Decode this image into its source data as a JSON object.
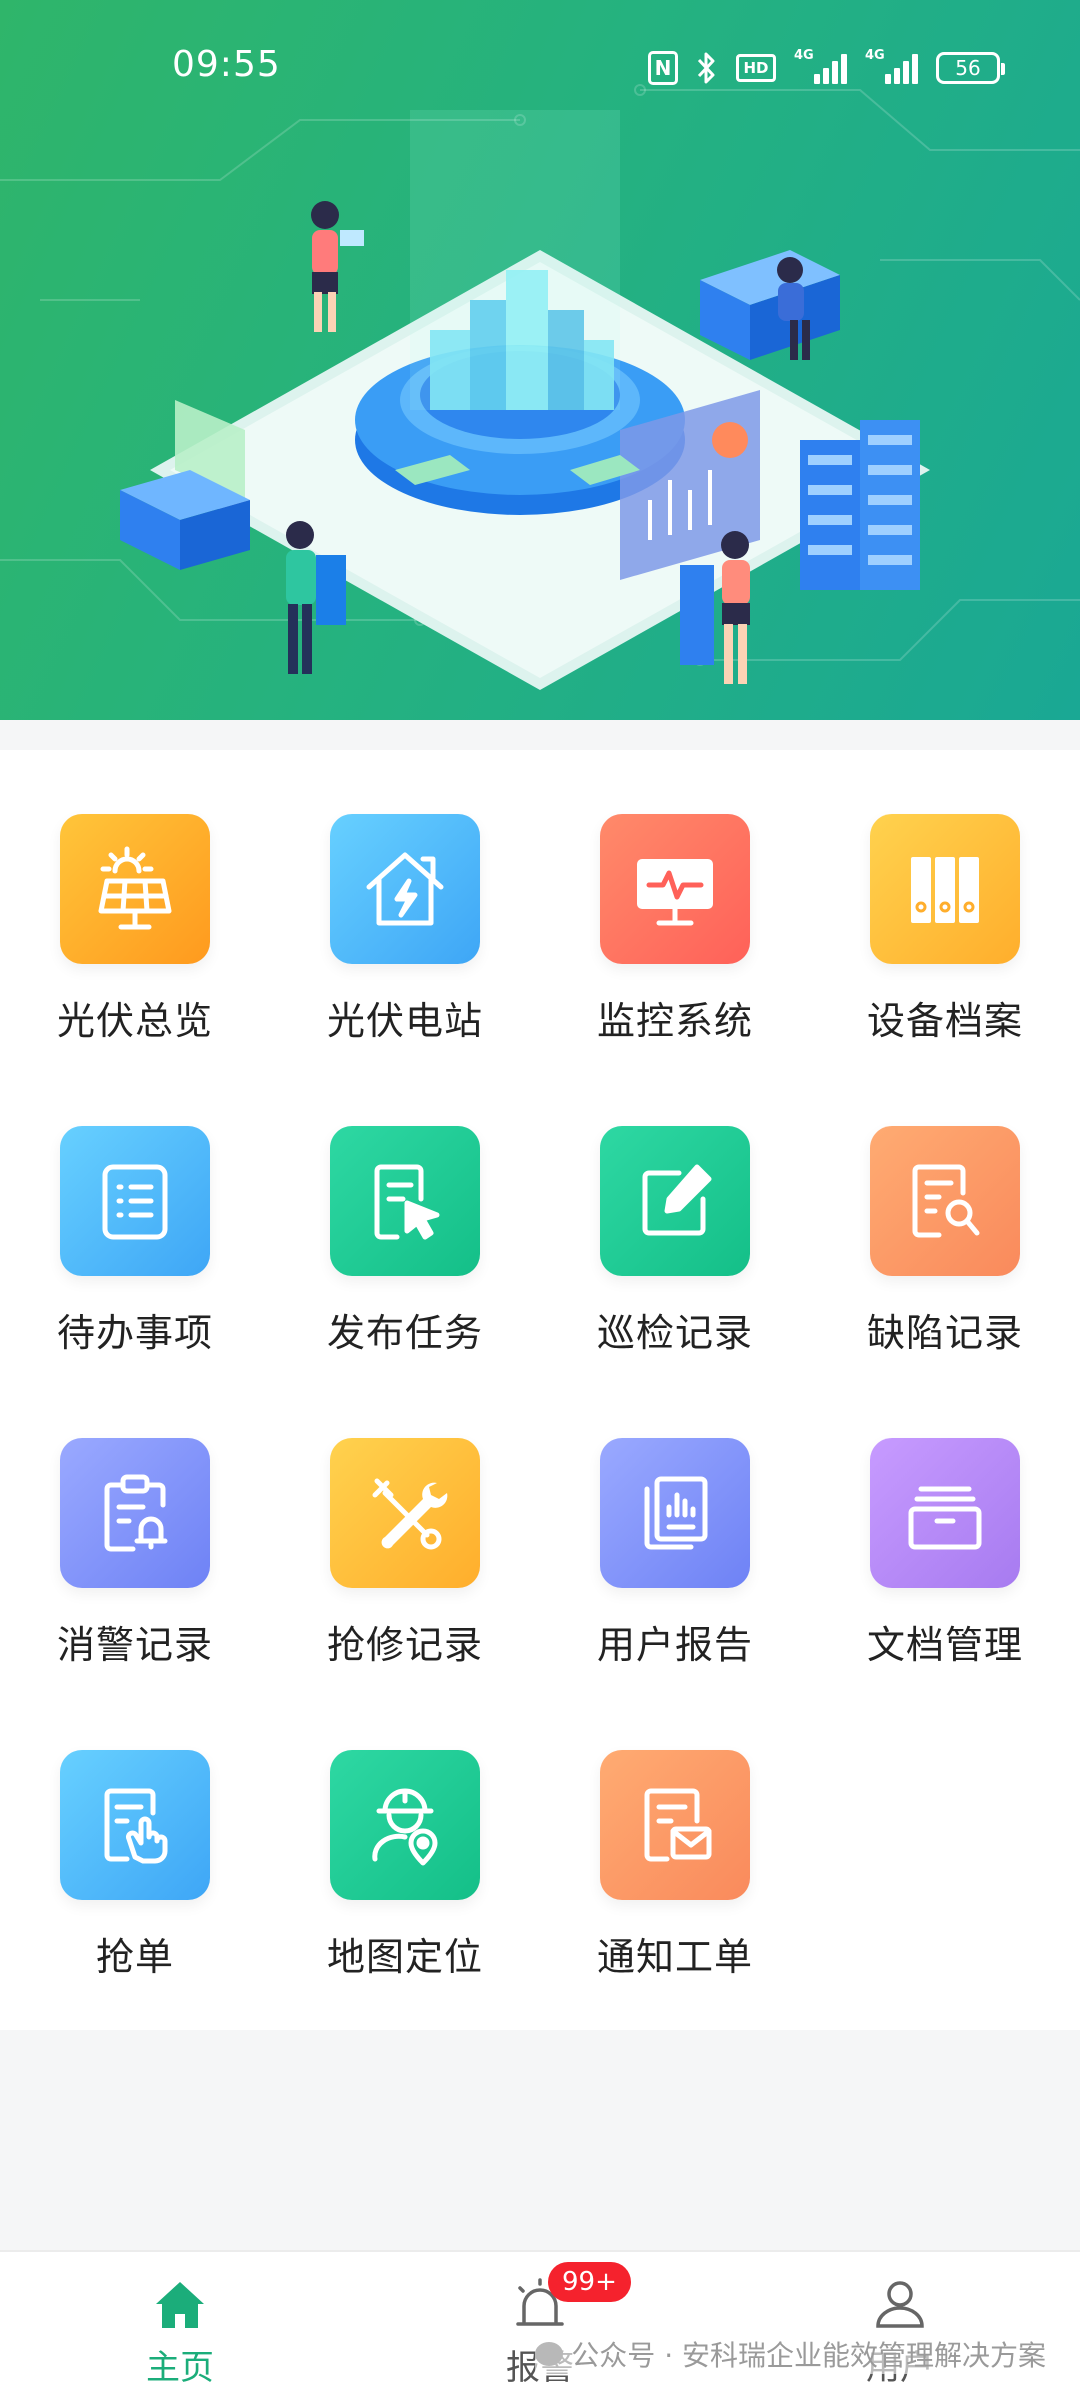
{
  "status_bar": {
    "time": "09:55",
    "nfc": "N",
    "hd": "HD",
    "signal1_label": "4G",
    "signal2_label": "4G",
    "battery": "56"
  },
  "banner": {
    "theme_color": "#25b27f"
  },
  "menu": {
    "items": [
      {
        "label": "光伏总览",
        "icon": "solar-panel-icon",
        "color": "#ff9a1e"
      },
      {
        "label": "光伏电站",
        "icon": "house-bolt-icon",
        "color": "#3ea6f6"
      },
      {
        "label": "监控系统",
        "icon": "monitor-pulse-icon",
        "color": "#ff6159"
      },
      {
        "label": "设备档案",
        "icon": "binders-icon",
        "color": "#ffae2c"
      },
      {
        "label": "待办事项",
        "icon": "checklist-icon",
        "color": "#3ea6f6"
      },
      {
        "label": "发布任务",
        "icon": "document-cursor-icon",
        "color": "#14bf88"
      },
      {
        "label": "巡检记录",
        "icon": "edit-note-icon",
        "color": "#14bf88"
      },
      {
        "label": "缺陷记录",
        "icon": "document-search-icon",
        "color": "#f98a5c"
      },
      {
        "label": "消警记录",
        "icon": "clipboard-bell-icon",
        "color": "#6e82f5"
      },
      {
        "label": "抢修记录",
        "icon": "wrench-screwdriver-icon",
        "color": "#ffae2c"
      },
      {
        "label": "用户报告",
        "icon": "report-chart-icon",
        "color": "#6e82f5"
      },
      {
        "label": "文档管理",
        "icon": "folder-icon",
        "color": "#a77bf0"
      },
      {
        "label": "抢单",
        "icon": "tap-document-icon",
        "color": "#3ea6f6"
      },
      {
        "label": "地图定位",
        "icon": "worker-location-icon",
        "color": "#14bf88"
      },
      {
        "label": "通知工单",
        "icon": "document-mail-icon",
        "color": "#f98a5c"
      }
    ]
  },
  "bottom_nav": {
    "items": [
      {
        "label": "主页",
        "icon": "home-icon",
        "active": true
      },
      {
        "label": "报警",
        "icon": "alarm-icon",
        "badge": "99+"
      },
      {
        "label": "用户",
        "icon": "user-icon"
      }
    ],
    "active_color": "#1bad7a"
  },
  "watermark": "公众号 · 安科瑞企业能效管理解决方案"
}
